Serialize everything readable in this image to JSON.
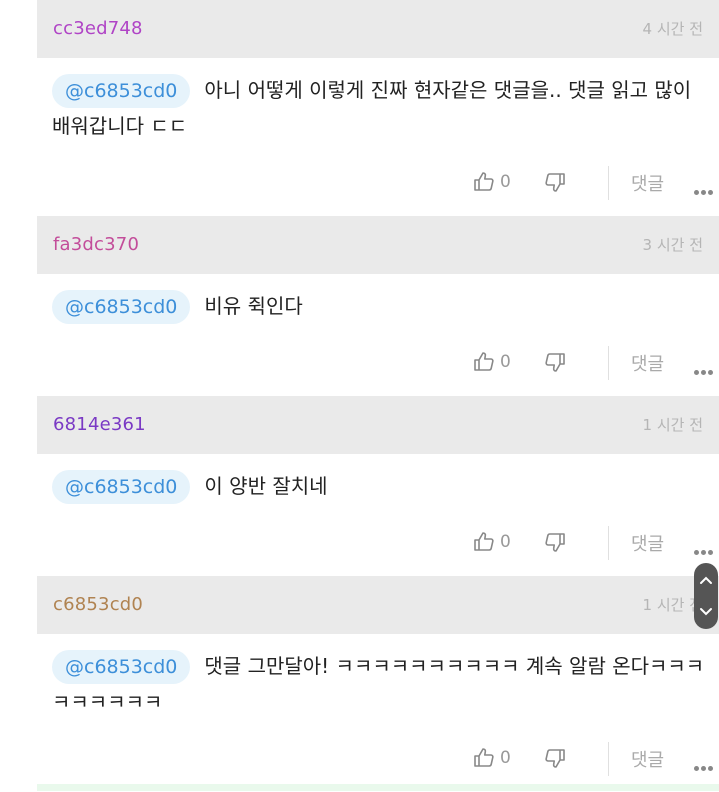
{
  "colors": {
    "author_purple": "#b044c6",
    "author_pink": "#c34d9a",
    "author_violet": "#7a39c4",
    "author_brown": "#b08351",
    "mention_text": "#3d8fd9",
    "mention_bg": "#e6f3fb"
  },
  "icons": {
    "like": "thumbs-up-icon",
    "dislike": "thumbs-down-icon",
    "more": "more-dots-icon",
    "scroll": "scroll-handle"
  },
  "comments": [
    {
      "author": "cc3ed748",
      "time": "4 시간 전",
      "mention": "@c6853cd0",
      "text": "아니 어떻게 이렇게 진짜 현자같은 댓글을.. 댓글 읽고 많이 배워갑니다 ㄷㄷ",
      "likes": "0",
      "reply_label": "댓글"
    },
    {
      "author": "fa3dc370",
      "time": "3 시간 전",
      "mention": "@c6853cd0",
      "text": "비유 쥑인다",
      "likes": "0",
      "reply_label": "댓글"
    },
    {
      "author": "6814e361",
      "time": "1 시간 전",
      "mention": "@c6853cd0",
      "text": "이 양반 잘치네",
      "likes": "0",
      "reply_label": "댓글"
    },
    {
      "author": "c6853cd0",
      "time": "1 시간 전",
      "mention": "@c6853cd0",
      "text": "댓글 그만달아! ㅋㅋㅋㅋㅋㅋㅋㅋㅋㅋ 계속 알람 온다ㅋㅋㅋㅋㅋㅋㅋㅋㅋ",
      "likes": "0",
      "reply_label": "댓글"
    }
  ]
}
